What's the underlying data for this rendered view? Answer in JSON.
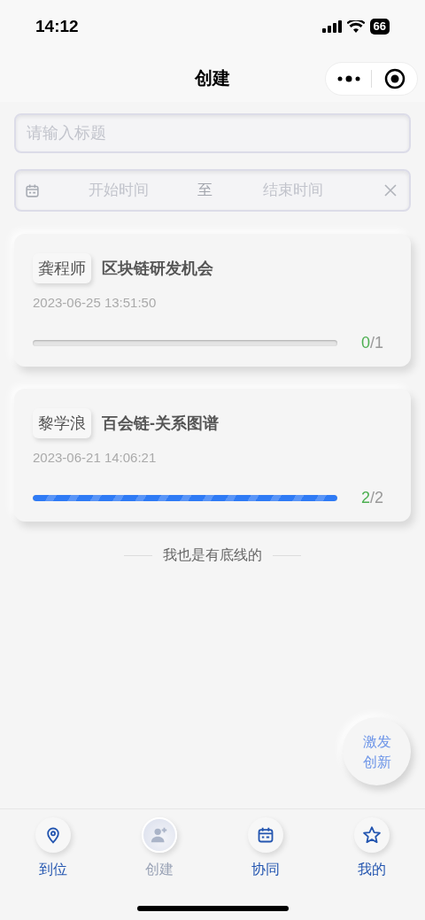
{
  "status_bar": {
    "time": "14:12",
    "battery": "66"
  },
  "nav": {
    "title": "创建"
  },
  "title_field": {
    "placeholder": "请输入标题"
  },
  "date_range": {
    "start_placeholder": "开始时间",
    "separator": "至",
    "end_placeholder": "结束时间"
  },
  "projects": [
    {
      "owner": "龚程师",
      "title": "区块链研发机会",
      "time": "2023-06-25 13:51:50",
      "done": "0",
      "slash": "/",
      "total": "1",
      "level": 0
    },
    {
      "owner": "黎学浪",
      "title": "百会链-关系图谱",
      "time": "2023-06-21 14:06:21",
      "done": "2",
      "slash": "/",
      "total": "2",
      "level": 1
    }
  ],
  "end_note": "我也是有底线的",
  "fab": {
    "line1": "激发",
    "line2": "创新"
  },
  "tabs": [
    {
      "label": "到位",
      "selected": false
    },
    {
      "label": "创建",
      "selected": true
    },
    {
      "label": "协同",
      "selected": false
    },
    {
      "label": "我的",
      "selected": false
    }
  ]
}
